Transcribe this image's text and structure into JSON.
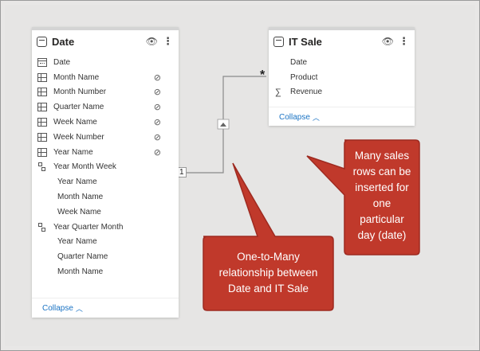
{
  "date_table": {
    "title": "Date",
    "fields": [
      {
        "name": "Date",
        "icon": "calendar-icon",
        "hidden": false
      },
      {
        "name": "Month Name",
        "icon": "column-icon",
        "hidden": true
      },
      {
        "name": "Month Number",
        "icon": "column-icon",
        "hidden": true
      },
      {
        "name": "Quarter Name",
        "icon": "column-icon",
        "hidden": true
      },
      {
        "name": "Week Name",
        "icon": "column-icon",
        "hidden": true
      },
      {
        "name": "Week Number",
        "icon": "column-icon",
        "hidden": true
      },
      {
        "name": "Year Name",
        "icon": "column-icon",
        "hidden": true
      }
    ],
    "hierarchies": [
      {
        "name": "Year Month Week",
        "levels": [
          "Year Name",
          "Month Name",
          "Week Name"
        ]
      },
      {
        "name": "Year Quarter Month",
        "levels": [
          "Year Name",
          "Quarter Name",
          "Month Name"
        ]
      }
    ],
    "collapse_label": "Collapse"
  },
  "it_sale_table": {
    "title": "IT Sale",
    "fields": [
      {
        "name": "Date"
      },
      {
        "name": "Product"
      },
      {
        "name": "Revenue",
        "icon": "sigma-icon"
      }
    ],
    "collapse_label": "Collapse"
  },
  "relationship": {
    "one_side": "1",
    "many_side": "*",
    "filter_direction_icon": "triangle-up-icon"
  },
  "callouts": {
    "relationship_note": [
      "One-to-Many",
      "relationship between",
      "Date and IT Sale"
    ],
    "sales_note": [
      "Many sales",
      "rows can be",
      "inserted for",
      "one",
      "particular",
      "day (date)"
    ]
  },
  "colors": {
    "callout_fill": "#c0392b",
    "callout_stroke": "#9e2a20",
    "canvas": "#e6e5e4",
    "link": "#1a73c4"
  }
}
